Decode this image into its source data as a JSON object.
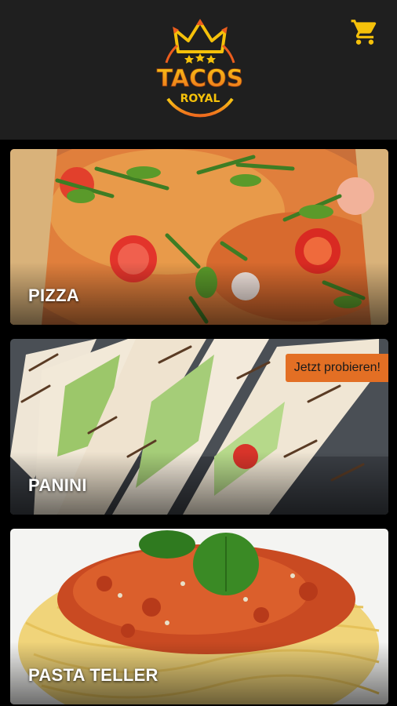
{
  "header": {
    "logo": {
      "line1": "TACOS",
      "line2": "ROYAL",
      "primary_color": "#f5c10a",
      "accent_color": "#ec5d1d",
      "icon": "crown-icon"
    },
    "cart": {
      "icon": "shopping-cart-icon",
      "color": "#f5c10a"
    }
  },
  "categories": [
    {
      "label": "PIZZA",
      "image": "pizza-photo"
    },
    {
      "label": "PANINI",
      "image": "panini-photo",
      "badge": "Jetzt probieren!"
    },
    {
      "label": "PASTA TELLER",
      "image": "pasta-photo"
    }
  ],
  "colors": {
    "header_bg": "#1f1f1f",
    "page_bg": "#000000",
    "badge_bg": "#e36f24",
    "label_text": "#ffffff"
  }
}
